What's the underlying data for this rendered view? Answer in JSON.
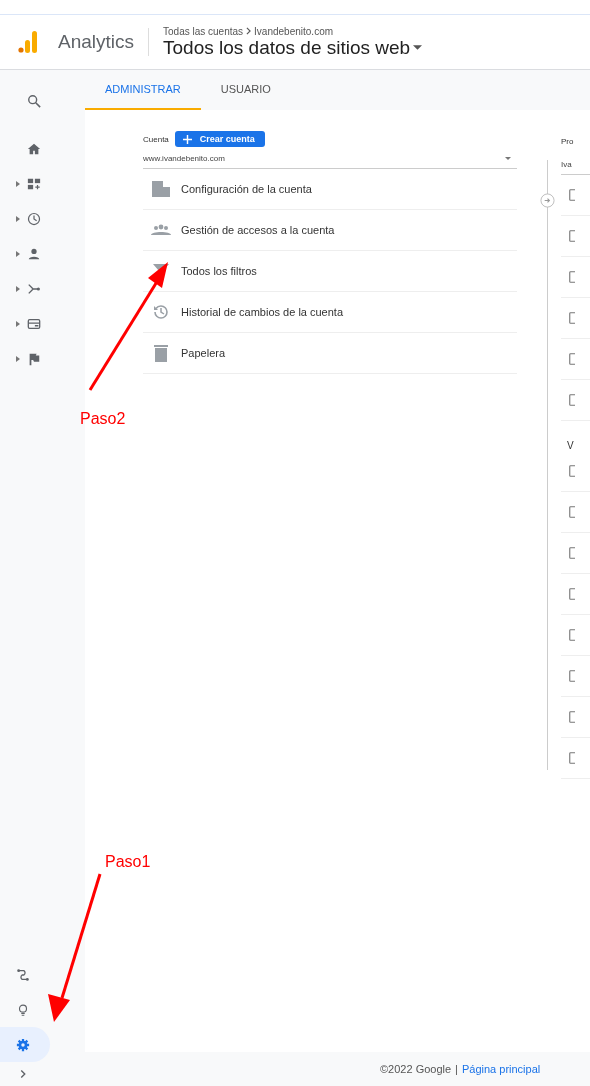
{
  "header": {
    "app_name": "Analytics",
    "breadcrumb": [
      "Todas las cuentas",
      "Ivandebenito.com"
    ],
    "view_title": "Todos los datos de sitios web"
  },
  "tabs": [
    {
      "label": "ADMINISTRAR",
      "selected": true
    },
    {
      "label": "USUARIO",
      "selected": false
    }
  ],
  "sidebar": {
    "top_items": [
      {
        "kind": "search",
        "expandable": false
      },
      {
        "kind": "home",
        "expandable": false
      },
      {
        "kind": "dashboard",
        "expandable": true
      },
      {
        "kind": "clock",
        "expandable": true
      },
      {
        "kind": "person",
        "expandable": true
      },
      {
        "kind": "acquisition",
        "expandable": true
      },
      {
        "kind": "behavior",
        "expandable": true
      },
      {
        "kind": "flag",
        "expandable": true
      }
    ],
    "bottom_items": [
      {
        "kind": "route",
        "selected": false
      },
      {
        "kind": "bulb",
        "selected": false
      },
      {
        "kind": "gear",
        "selected": true
      },
      {
        "kind": "chevron",
        "selected": false
      }
    ]
  },
  "account": {
    "label": "Cuenta",
    "create_button": "Crear cuenta",
    "selector_value": "www.ivandebenito.com",
    "items": [
      {
        "kind": "building",
        "label": "Configuración de la cuenta"
      },
      {
        "kind": "people",
        "label": "Gestión de accesos a la cuenta"
      },
      {
        "kind": "filter",
        "label": "Todos los filtros"
      },
      {
        "kind": "history",
        "label": "Historial de cambios de la cuenta"
      },
      {
        "kind": "trash",
        "label": "Papelera"
      }
    ]
  },
  "property": {
    "label": "Pro",
    "selector_value": "Iva",
    "items": [
      {
        "kind": "row"
      },
      {
        "kind": "row"
      },
      {
        "kind": "row"
      },
      {
        "kind": "row"
      },
      {
        "kind": "row"
      },
      {
        "kind": "row"
      },
      {
        "kind": "heading",
        "text": "V"
      },
      {
        "kind": "row"
      },
      {
        "kind": "row"
      },
      {
        "kind": "row"
      },
      {
        "kind": "row"
      },
      {
        "kind": "row"
      },
      {
        "kind": "row"
      },
      {
        "kind": "row"
      },
      {
        "kind": "row"
      }
    ]
  },
  "annotations": [
    {
      "text": "Paso2"
    },
    {
      "text": "Paso1"
    }
  ],
  "footer": {
    "copyright": "©2022 Google",
    "separator": "|",
    "link": "Página principal"
  }
}
